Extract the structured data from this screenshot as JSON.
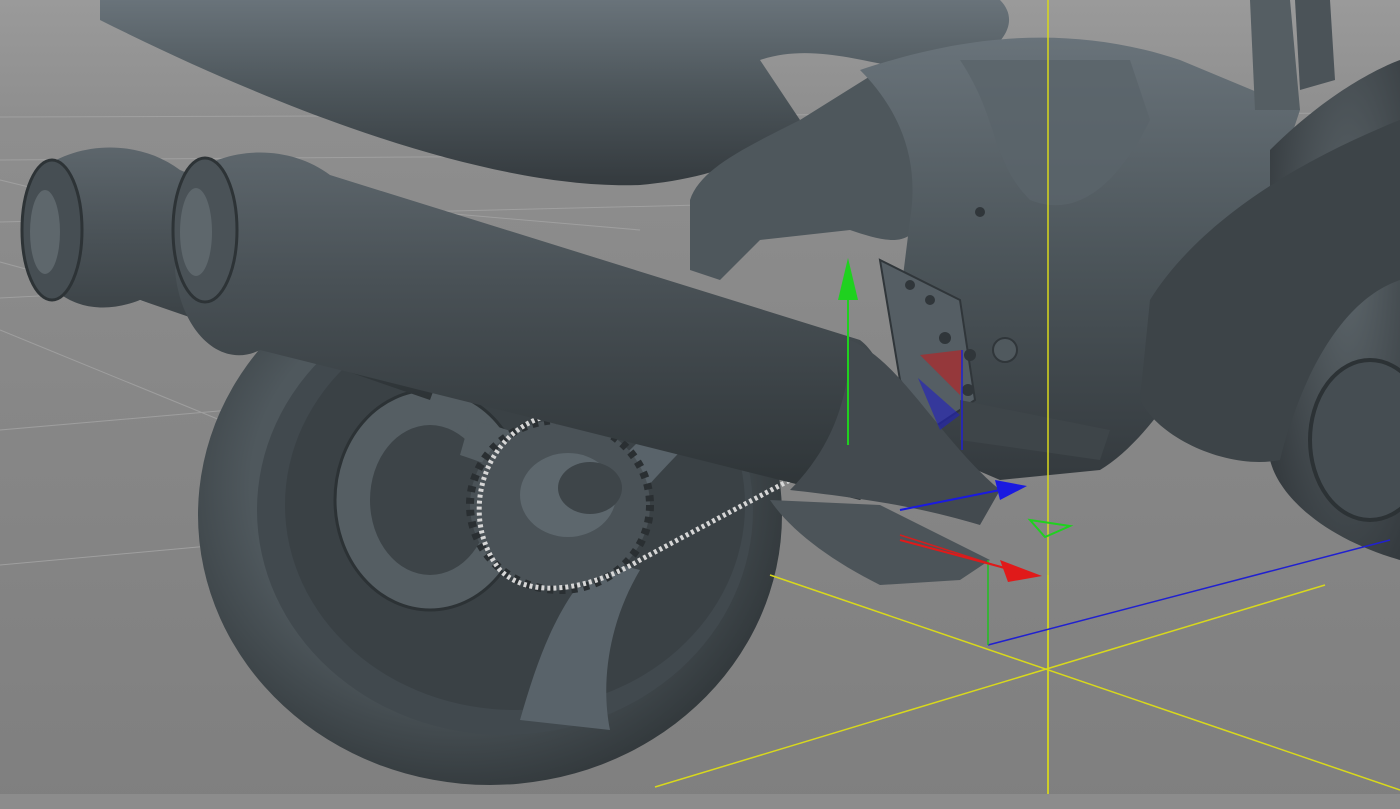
{
  "viewport": {
    "name": "3d-viewport",
    "content": "motorcycle-rear-model"
  },
  "colors": {
    "background": "#8a8a8a",
    "grid": "#a9a9a9",
    "model_body": "#4b5358",
    "model_highlight": "#6e777c",
    "model_shadow": "#30363a",
    "chain": "#d9d9d9",
    "axis_x": "#e01a1a",
    "axis_y": "#1fd11f",
    "axis_z": "#1a1ae0",
    "world_axis": "#d6d61a"
  },
  "gizmos": {
    "move_gizmo": {
      "axes": [
        "x",
        "y",
        "z"
      ],
      "icon": "move-gizmo-icon"
    },
    "world_axis_marker": {
      "icon": "world-origin-icon"
    }
  }
}
